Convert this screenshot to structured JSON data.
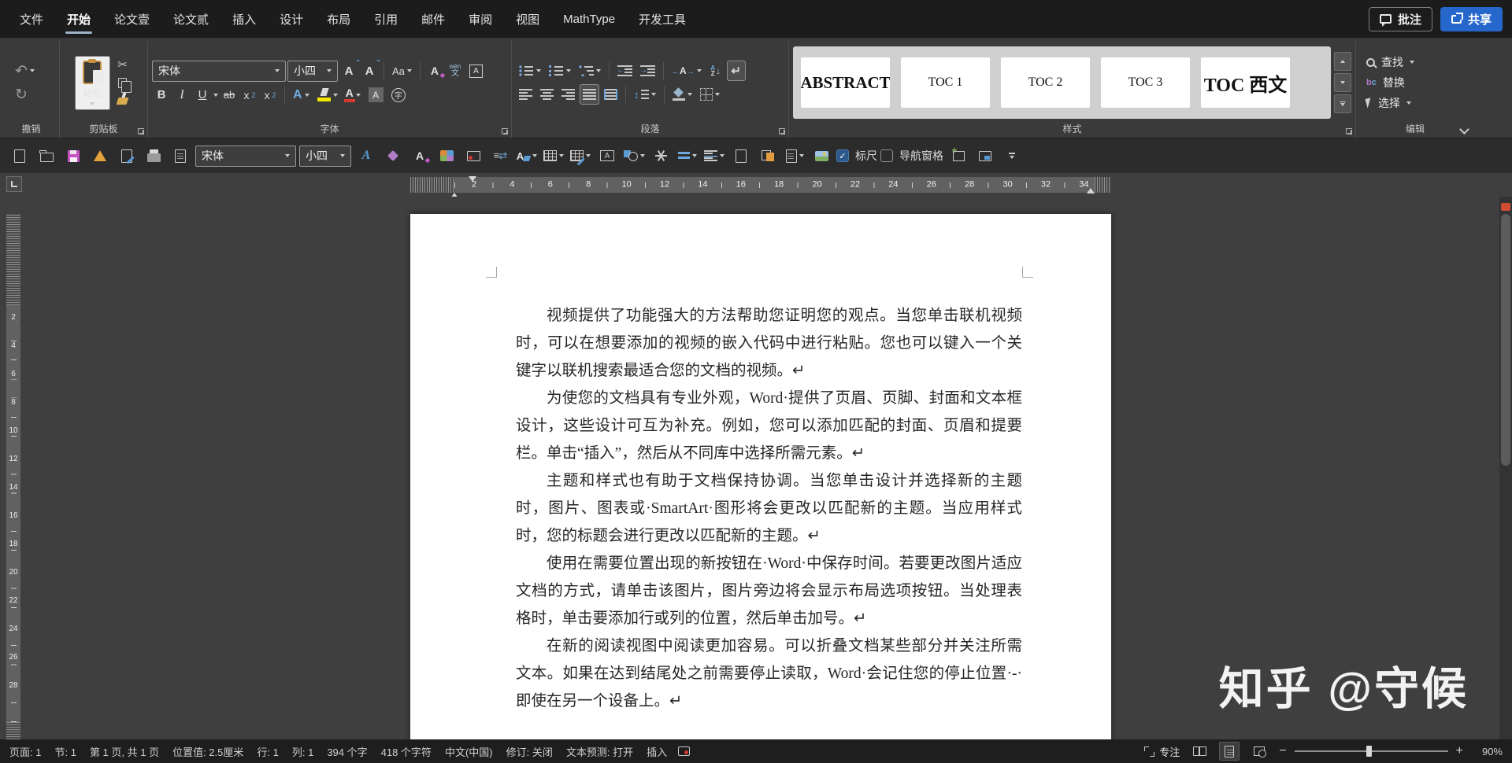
{
  "titlebar": {
    "menu_items": [
      "文件",
      "开始",
      "论文壹",
      "论文贰",
      "插入",
      "设计",
      "布局",
      "引用",
      "邮件",
      "审阅",
      "视图",
      "MathType",
      "开发工具"
    ],
    "active_tab": "开始",
    "comments_label": "批注",
    "share_label": "共享"
  },
  "ribbon": {
    "font_name": "宋体",
    "font_size": "小四",
    "paste_label": "粘贴",
    "phonetic_top": "wén",
    "phonetic_bottom": "文",
    "enclose_char": "字",
    "groups": {
      "undo": "撤销",
      "clipboard": "剪贴板",
      "font": "字体",
      "paragraph": "段落",
      "styles": "样式",
      "editing": "编辑"
    },
    "styles_gallery": [
      "ABSTRACT",
      "TOC 1",
      "TOC 2",
      "TOC 3",
      "TOC 西文"
    ],
    "editing": {
      "find": "查找",
      "replace": "替换",
      "select": "选择"
    }
  },
  "toolbar2": {
    "font_name": "宋体",
    "font_size": "小四",
    "ruler_label": "标尺",
    "ruler_checked": true,
    "nav_label": "导航窗格",
    "nav_checked": false
  },
  "ruler": {
    "numbers": [
      2,
      4,
      6,
      8,
      10,
      12,
      14,
      16,
      18,
      20,
      22,
      24,
      26,
      28,
      30,
      32,
      34
    ],
    "vertical_numbers": [
      2,
      4,
      6,
      8,
      10,
      12,
      14,
      16,
      18,
      20,
      22,
      24,
      26,
      28
    ]
  },
  "document": {
    "paragraphs": [
      "视频提供了功能强大的方法帮助您证明您的观点。当您单击联机视频时，可以在想要添加的视频的嵌入代码中进行粘贴。您也可以键入一个关键字以联机搜索最适合您的文档的视频。↵",
      "为使您的文档具有专业外观，Word·提供了页眉、页脚、封面和文本框设计，这些设计可互为补充。例如，您可以添加匹配的封面、页眉和提要栏。单击“插入”，然后从不同库中选择所需元素。↵",
      "主题和样式也有助于文档保持协调。当您单击设计并选择新的主题时，图片、图表或·SmartArt·图形将会更改以匹配新的主题。当应用样式时，您的标题会进行更改以匹配新的主题。↵",
      "使用在需要位置出现的新按钮在·Word·中保存时间。若要更改图片适应文档的方式，请单击该图片，图片旁边将会显示布局选项按钮。当处理表格时，单击要添加行或列的位置，然后单击加号。↵",
      "在新的阅读视图中阅读更加容易。可以折叠文档某些部分并关注所需文本。如果在达到结尾处之前需要停止读取，Word·会记住您的停止位置·-·即使在另一个设备上。↵"
    ]
  },
  "watermark": "知乎 @守候",
  "statusbar": {
    "items": [
      "页面: 1",
      "节: 1",
      "第 1 页, 共 1 页",
      "位置值: 2.5厘米",
      "行: 1",
      "列: 1",
      "394 个字",
      "418 个字符",
      "中文(中国)",
      "修订: 关闭",
      "文本预测: 打开",
      "插入"
    ],
    "focus_label": "专注",
    "zoom": "90%"
  },
  "icons": {
    "undo": "↶",
    "redo": "↻",
    "cut": "✂",
    "check": "✓",
    "marks": "↵",
    "asian_layout": "A",
    "sort_a": "A",
    "sort_z": "Z",
    "sort_arrow": "↓",
    "line_spacing_arrow": "↕",
    "replace_b": "b",
    "replace_c": "c",
    "pmarks": "≡",
    "pmarks_arrow": "⇄"
  },
  "colors": {
    "titlebar_bg": "#1c1c1c",
    "ribbon_bg": "#3a3a3a",
    "toolbar2_bg": "#2c2c2c",
    "workspace_bg": "#3f3f3f",
    "statusbar_bg": "#1e1e1e",
    "share_button_blue": "#2667cc",
    "active_tab_underline": "#9db4ca",
    "save_magenta": "#c653c6",
    "warning_amber": "#e5a33c",
    "highlight_yellow": "#f3e600",
    "font_color_red": "#d83b2d",
    "gallery_bg": "#d0d0d0",
    "scroll_marker_red": "#d14b35"
  }
}
